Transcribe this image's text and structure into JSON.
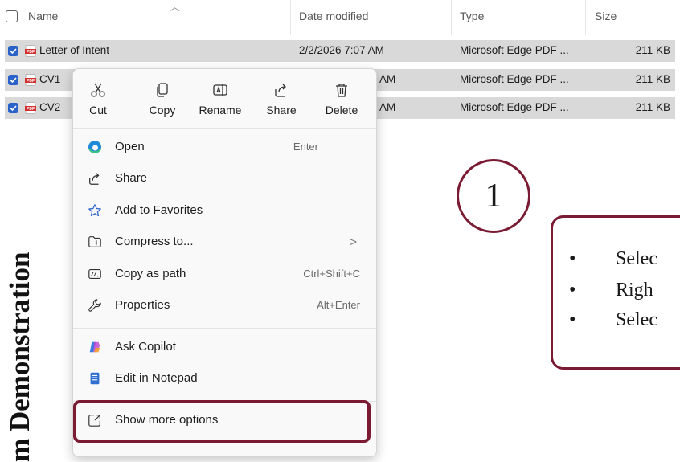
{
  "columns": {
    "name": "Name",
    "date": "Date modified",
    "type": "Type",
    "size": "Size"
  },
  "files": [
    {
      "name": "Letter of Intent",
      "date": "2/2/2026 7:07 AM",
      "type": "Microsoft Edge PDF ...",
      "size": "211 KB"
    },
    {
      "name": "CV1",
      "date": "AM",
      "type": "Microsoft Edge PDF ...",
      "size": "211 KB"
    },
    {
      "name": "CV2",
      "date": "AM",
      "type": "Microsoft Edge PDF ...",
      "size": "211 KB"
    }
  ],
  "quick_actions": [
    {
      "label": "Cut",
      "icon": "scissors-icon"
    },
    {
      "label": "Copy",
      "icon": "copy-icon"
    },
    {
      "label": "Rename",
      "icon": "rename-icon"
    },
    {
      "label": "Share",
      "icon": "share-icon"
    },
    {
      "label": "Delete",
      "icon": "trash-icon"
    }
  ],
  "menu_items": [
    {
      "label": "Open",
      "shortcut": "Enter",
      "icon": "edge-icon"
    },
    {
      "label": "Share",
      "shortcut": "",
      "icon": "share-icon"
    },
    {
      "label": "Add to Favorites",
      "shortcut": "",
      "icon": "star-icon"
    },
    {
      "label": "Compress to...",
      "shortcut": ">",
      "icon": "zip-folder-icon"
    },
    {
      "label": "Copy as path",
      "shortcut": "Ctrl+Shift+C",
      "icon": "path-icon"
    },
    {
      "label": "Properties",
      "shortcut": "Alt+Enter",
      "icon": "wrench-icon"
    },
    {
      "label": "Ask Copilot",
      "shortcut": "",
      "icon": "copilot-icon"
    },
    {
      "label": "Edit in Notepad",
      "shortcut": "",
      "icon": "notepad-icon"
    },
    {
      "label": "Show more options",
      "shortcut": "",
      "icon": "external-box-icon"
    }
  ],
  "banner_text": "m Demonstration",
  "step_number": "1",
  "instructions": [
    "Selec",
    "Righ",
    "Selec"
  ],
  "bullet": "•",
  "colors": {
    "accent": "#7a1a33",
    "selection": "#d9d9d9",
    "checkbox": "#2b62c9"
  }
}
